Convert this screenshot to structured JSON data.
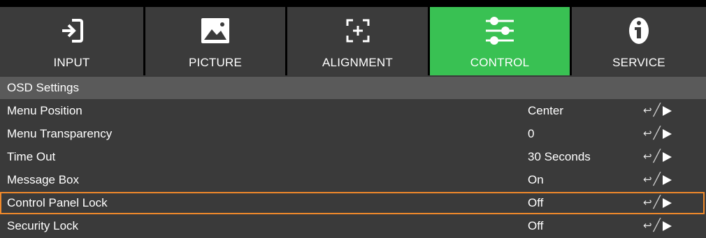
{
  "tabs": [
    {
      "label": "INPUT",
      "icon": "input-icon"
    },
    {
      "label": "PICTURE",
      "icon": "picture-icon"
    },
    {
      "label": "ALIGNMENT",
      "icon": "alignment-icon"
    },
    {
      "label": "CONTROL",
      "icon": "sliders-icon"
    },
    {
      "label": "SERVICE",
      "icon": "info-icon"
    }
  ],
  "active_tab": "CONTROL",
  "section_title": "OSD Settings",
  "rows": [
    {
      "name": "Menu Position",
      "value": "Center"
    },
    {
      "name": "Menu Transparency",
      "value": "0"
    },
    {
      "name": "Time Out",
      "value": "30 Seconds"
    },
    {
      "name": "Message Box",
      "value": "On"
    },
    {
      "name": "Control Panel Lock",
      "value": "Off"
    },
    {
      "name": "Security Lock",
      "value": "Off"
    }
  ],
  "nav_glyphs": {
    "enter": "↩",
    "slash": "╱"
  },
  "highlighted_row": "Control Panel Lock",
  "colors": {
    "active_tab": "#39c153",
    "highlight": "#f0892b",
    "background": "#3a3a3a"
  }
}
